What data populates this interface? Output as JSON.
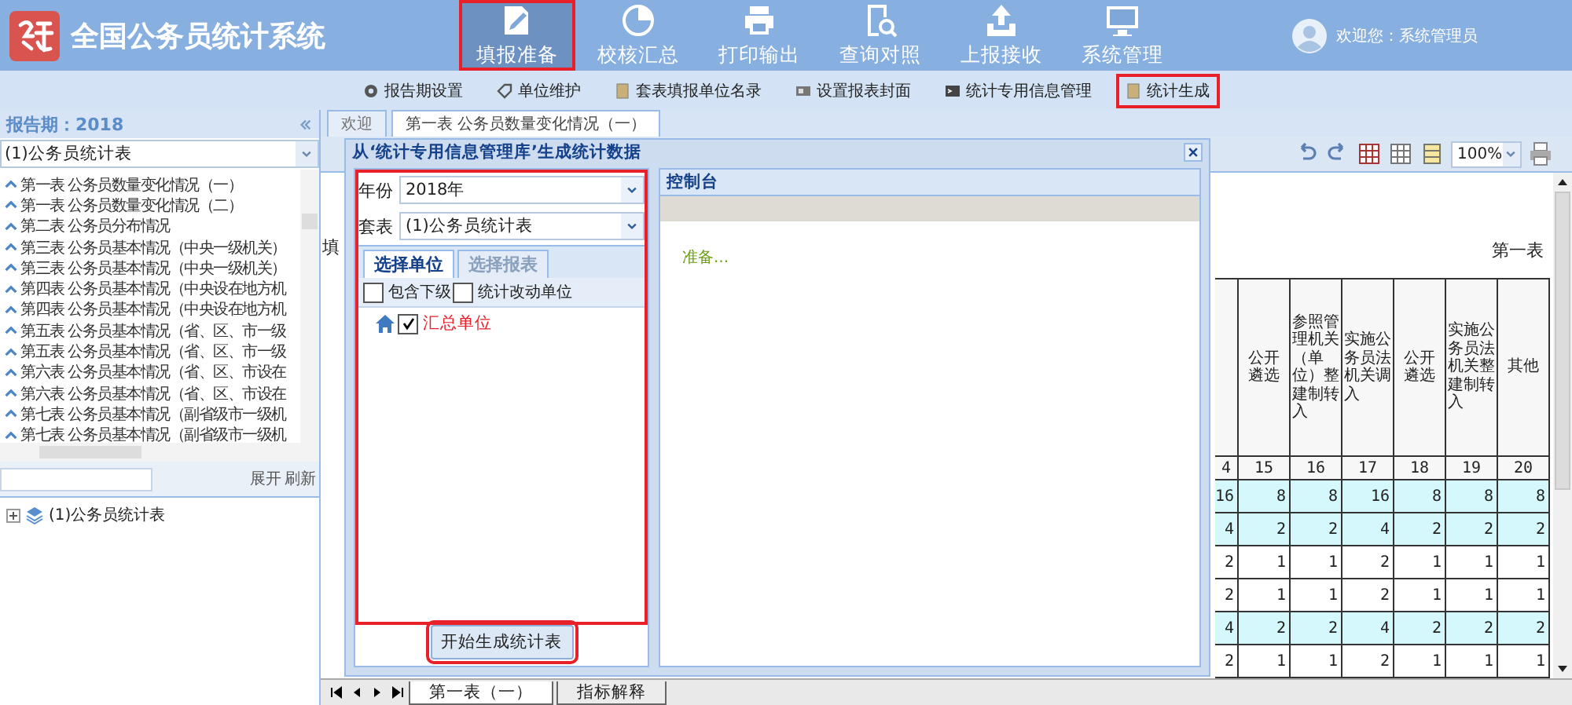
{
  "header": {
    "title": "全国公务员统计系统",
    "user": "欢迎您：系统管理员",
    "nav": [
      {
        "label": "填报准备",
        "selected": true,
        "highlighted": true
      },
      {
        "label": "校核汇总",
        "selected": false,
        "highlighted": false
      },
      {
        "label": "打印输出",
        "selected": false,
        "highlighted": false
      },
      {
        "label": "查询对照",
        "selected": false,
        "highlighted": false
      },
      {
        "label": "上报接收",
        "selected": false,
        "highlighted": false
      },
      {
        "label": "系统管理",
        "selected": false,
        "highlighted": false
      }
    ]
  },
  "subnav": [
    {
      "label": "报告期设置",
      "highlighted": false
    },
    {
      "label": "单位维护",
      "highlighted": false
    },
    {
      "label": "套表填报单位名录",
      "highlighted": false
    },
    {
      "label": "设置报表封面",
      "highlighted": false
    },
    {
      "label": "统计专用信息管理",
      "highlighted": false
    },
    {
      "label": "统计生成",
      "highlighted": true
    }
  ],
  "left_panel": {
    "title": "报告期：2018",
    "select": "(1)公务员统计表",
    "tables": [
      "第一表 公务员数量变化情况（一）",
      "第一表 公务员数量变化情况（二）",
      "第二表 公务员分布情况",
      "第三表 公务员基本情况（中央一级机关）",
      "第三表 公务员基本情况（中央一级机关）",
      "第四表 公务员基本情况（中央设在地方机",
      "第四表 公务员基本情况（中央设在地方机",
      "第五表 公务员基本情况（省、区、市一级",
      "第五表 公务员基本情况（省、区、市一级",
      "第六表 公务员基本情况（省、区、市设在",
      "第六表 公务员基本情况（省、区、市设在",
      "第七表 公务员基本情况（副省级市一级机",
      "第七表 公务员基本情况（副省级市一级机"
    ],
    "actions": [
      "展开",
      "刷新"
    ],
    "tree": [
      {
        "label": "(1)公务员统计表",
        "expanded": false
      }
    ]
  },
  "tabs": [
    {
      "label": "欢迎",
      "selected": false
    },
    {
      "label": "第一表 公务员数量变化情况（一）",
      "selected": true
    }
  ],
  "toolbar": {
    "zoom": "100%"
  },
  "sheet": {
    "row_label": "填",
    "table_no": "第一表",
    "columns": [
      {
        "number": "4"
      },
      {
        "header": "公开遴选",
        "number": "15"
      },
      {
        "header": "参照管理机关（单位）整建制转入",
        "number": "16"
      },
      {
        "header": "实施公务员法机关调入",
        "number": "17"
      },
      {
        "header": "公开遴选",
        "number": "18"
      },
      {
        "header": "实施公务员法机关整建制转入",
        "number": "19"
      },
      {
        "header": "其他",
        "number": "20"
      }
    ],
    "rows": [
      {
        "shaded": true,
        "cells": [
          "16",
          "8",
          "8",
          "16",
          "8",
          "8",
          "8"
        ]
      },
      {
        "shaded": true,
        "cells": [
          "4",
          "2",
          "2",
          "4",
          "2",
          "2",
          "2"
        ]
      },
      {
        "shaded": false,
        "cells": [
          "2",
          "1",
          "1",
          "2",
          "1",
          "1",
          "1"
        ]
      },
      {
        "shaded": false,
        "cells": [
          "2",
          "1",
          "1",
          "2",
          "1",
          "1",
          "1"
        ]
      },
      {
        "shaded": true,
        "cells": [
          "4",
          "2",
          "2",
          "4",
          "2",
          "2",
          "2"
        ]
      },
      {
        "shaded": false,
        "cells": [
          "2",
          "1",
          "1",
          "2",
          "1",
          "1",
          "1"
        ]
      }
    ]
  },
  "dialog": {
    "title": "从‘统计专用信息管理库’生成统计数据",
    "highlighted": true,
    "year_label": "年份",
    "year": "2018年",
    "set_label": "套表",
    "set": "(1)公务员统计表",
    "tabs": [
      {
        "label": "选择单位",
        "selected": true
      },
      {
        "label": "选择报表",
        "selected": false
      }
    ],
    "options": [
      {
        "label": "包含下级",
        "checked": false
      },
      {
        "label": "统计改动单位",
        "checked": false
      }
    ],
    "units": [
      {
        "label": "汇总单位",
        "checked": true
      }
    ],
    "button": {
      "label": "开始生成统计表",
      "highlighted": true
    },
    "console": {
      "title": "控制台",
      "message": "准备..."
    }
  },
  "sheet_tabs": [
    {
      "label": "第一表（一）",
      "selected": true
    },
    {
      "label": "指标解释",
      "selected": false
    }
  ]
}
